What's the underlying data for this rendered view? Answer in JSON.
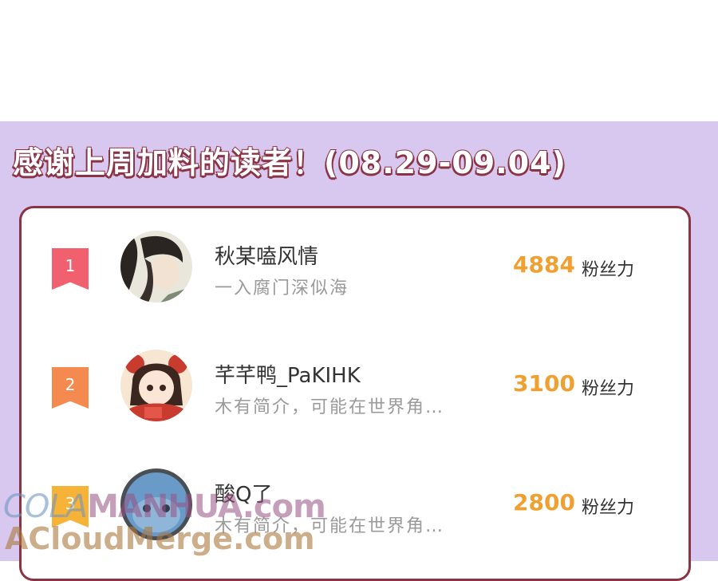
{
  "header": {
    "title": "感谢上周加料的读者！(08.29-09.04)"
  },
  "readers": [
    {
      "rank": "1",
      "badge_color": "#f0606e",
      "name": "秋某嗑风情",
      "intro": "一入腐门深似海",
      "score": "4884",
      "unit": "粉丝力"
    },
    {
      "rank": "2",
      "badge_color": "#f58a50",
      "name": "芊芊鸭_PaKIHK",
      "intro": "木有简介，可能在世界角…",
      "score": "3100",
      "unit": "粉丝力"
    },
    {
      "rank": "3",
      "badge_color": "#f7b238",
      "name": "酸Q了",
      "intro": "木有简介，可能在世界角…",
      "score": "2800",
      "unit": "粉丝力"
    }
  ],
  "watermark": {
    "line1_prefix": "COLA",
    "line1_main": "MANHUA.com",
    "line2": "ACloudMerge.com"
  }
}
